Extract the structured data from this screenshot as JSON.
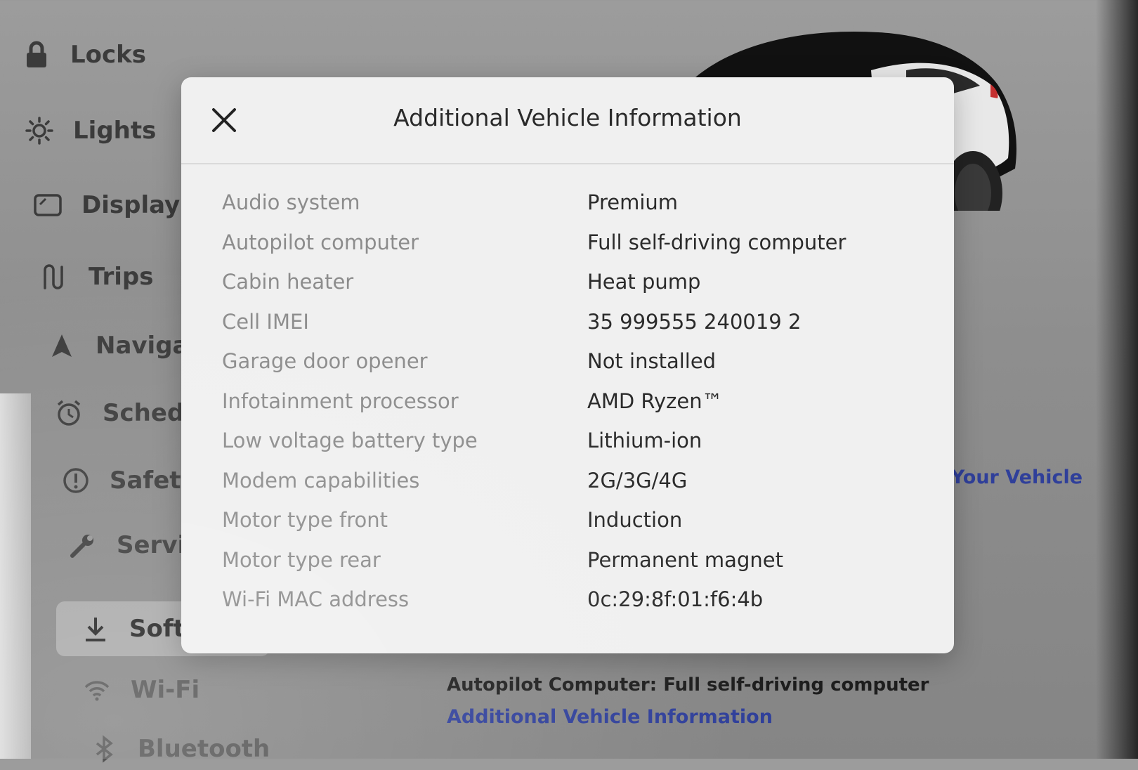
{
  "sidebar": {
    "items": [
      {
        "label": "Locks",
        "icon": "lock-icon"
      },
      {
        "label": "Lights",
        "icon": "sun-icon"
      },
      {
        "label": "Display",
        "icon": "display-icon"
      },
      {
        "label": "Trips",
        "icon": "trips-icon"
      },
      {
        "label": "Navigati",
        "icon": "navigation-arrow-icon"
      },
      {
        "label": "Schedule",
        "icon": "alarm-clock-icon"
      },
      {
        "label": "Safety",
        "icon": "alert-circle-icon"
      },
      {
        "label": "Service",
        "icon": "wrench-icon"
      },
      {
        "label": "Software",
        "icon": "download-icon",
        "selected": true
      },
      {
        "label": "Wi-Fi",
        "icon": "wifi-icon"
      },
      {
        "label": "Bluetooth",
        "icon": "bluetooth-icon"
      }
    ]
  },
  "background": {
    "vehicle_link_partial": "e Your Vehicle",
    "autopilot_text": "Autopilot Computer: Full self-driving computer",
    "additional_info_link": "Additional Vehicle Information"
  },
  "modal": {
    "title": "Additional Vehicle Information",
    "close_icon": "close-icon",
    "rows": [
      {
        "label": "Audio system",
        "value": "Premium"
      },
      {
        "label": "Autopilot computer",
        "value": "Full self-driving computer"
      },
      {
        "label": "Cabin heater",
        "value": "Heat pump"
      },
      {
        "label": "Cell IMEI",
        "value": "35 999555 240019 2"
      },
      {
        "label": "Garage door opener",
        "value": "Not installed"
      },
      {
        "label": "Infotainment processor",
        "value": "AMD Ryzen™"
      },
      {
        "label": "Low voltage battery type",
        "value": "Lithium-ion"
      },
      {
        "label": "Modem capabilities",
        "value": "2G/3G/4G"
      },
      {
        "label": "Motor type front",
        "value": "Induction"
      },
      {
        "label": "Motor type rear",
        "value": "Permanent magnet"
      },
      {
        "label": "Wi-Fi MAC address",
        "value": "0c:29:8f:01:f6:4b"
      }
    ]
  },
  "colors": {
    "link_blue": "#2f3f9a",
    "modal_bg": "#f0f0f0",
    "label_gray": "#8c8c8c",
    "value_dark": "#2b2b2b"
  }
}
